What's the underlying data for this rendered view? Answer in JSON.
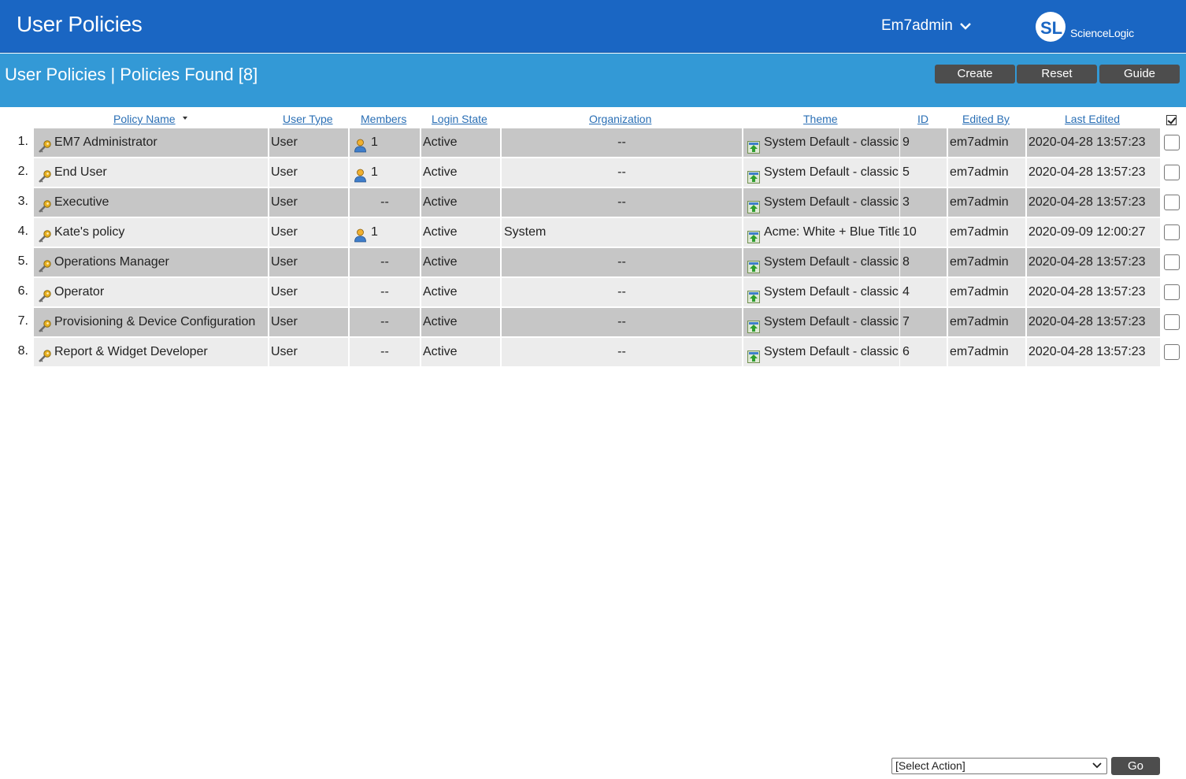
{
  "header": {
    "app_title": "User Policies",
    "user_name": "Em7admin",
    "logo_text": "ScienceLogic",
    "brand_color": "#1a66c3",
    "subbar_color": "#3399d6"
  },
  "toolbar": {
    "title": "User Policies | Policies Found [8]",
    "create_label": "Create",
    "reset_label": "Reset",
    "guide_label": "Guide"
  },
  "table": {
    "columns": {
      "policy_name": "Policy Name",
      "user_type": "User Type",
      "members": "Members",
      "login_state": "Login State",
      "organization": "Organization",
      "theme": "Theme",
      "id": "ID",
      "edited_by": "Edited By",
      "last_edited": "Last Edited"
    },
    "sorted_by": "Policy Name",
    "rows": [
      {
        "idx": "1.",
        "name": "EM7 Administrator",
        "type": "User",
        "members": "1",
        "has_members": true,
        "login": "Active",
        "org": "--",
        "theme": "System Default - classic",
        "id": "9",
        "edited_by": "em7admin",
        "last_edited": "2020-04-28 13:57:23"
      },
      {
        "idx": "2.",
        "name": "End User",
        "type": "User",
        "members": "1",
        "has_members": true,
        "login": "Active",
        "org": "--",
        "theme": "System Default - classic",
        "id": "5",
        "edited_by": "em7admin",
        "last_edited": "2020-04-28 13:57:23"
      },
      {
        "idx": "3.",
        "name": "Executive",
        "type": "User",
        "members": "--",
        "has_members": false,
        "login": "Active",
        "org": "--",
        "theme": "System Default - classic",
        "id": "3",
        "edited_by": "em7admin",
        "last_edited": "2020-04-28 13:57:23"
      },
      {
        "idx": "4.",
        "name": "Kate's policy",
        "type": "User",
        "members": "1",
        "has_members": true,
        "login": "Active",
        "org": "System",
        "theme": "Acme: White + Blue Title",
        "id": "10",
        "edited_by": "em7admin",
        "last_edited": "2020-09-09 12:00:27"
      },
      {
        "idx": "5.",
        "name": "Operations Manager",
        "type": "User",
        "members": "--",
        "has_members": false,
        "login": "Active",
        "org": "--",
        "theme": "System Default - classic",
        "id": "8",
        "edited_by": "em7admin",
        "last_edited": "2020-04-28 13:57:23"
      },
      {
        "idx": "6.",
        "name": "Operator",
        "type": "User",
        "members": "--",
        "has_members": false,
        "login": "Active",
        "org": "--",
        "theme": "System Default - classic",
        "id": "4",
        "edited_by": "em7admin",
        "last_edited": "2020-04-28 13:57:23"
      },
      {
        "idx": "7.",
        "name": "Provisioning & Device Configuration",
        "type": "User",
        "members": "--",
        "has_members": false,
        "login": "Active",
        "org": "--",
        "theme": "System Default - classic",
        "id": "7",
        "edited_by": "em7admin",
        "last_edited": "2020-04-28 13:57:23"
      },
      {
        "idx": "8.",
        "name": "Report & Widget Developer",
        "type": "User",
        "members": "--",
        "has_members": false,
        "login": "Active",
        "org": "--",
        "theme": "System Default - classic",
        "id": "6",
        "edited_by": "em7admin",
        "last_edited": "2020-04-28 13:57:23"
      }
    ]
  },
  "footer": {
    "action_select": "[Select Action]",
    "go_label": "Go"
  }
}
